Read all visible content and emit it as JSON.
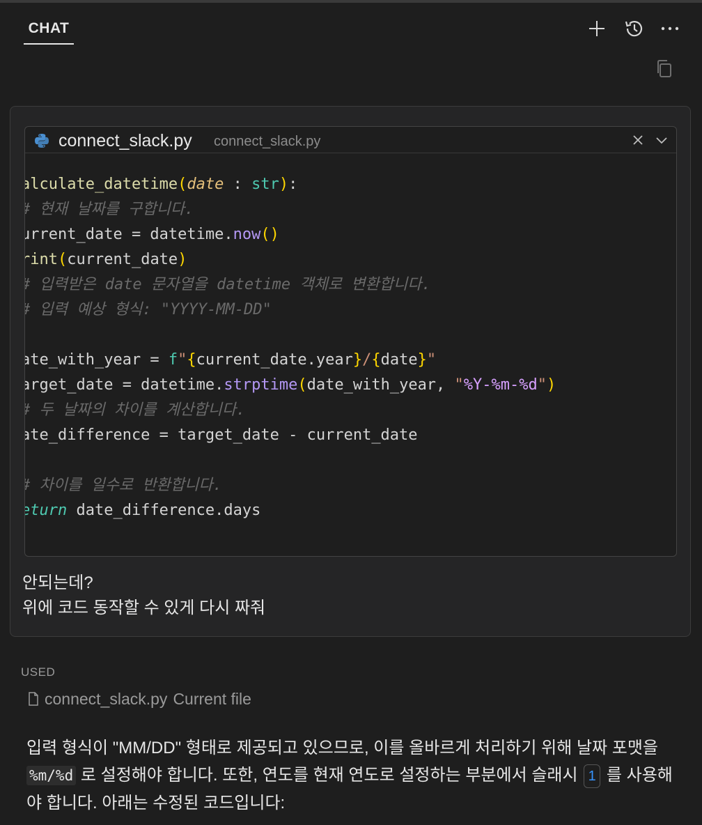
{
  "header": {
    "tab_label": "CHAT",
    "icons": [
      "plus-icon",
      "history-icon",
      "more-icon"
    ]
  },
  "user_message": {
    "attachment": {
      "file_name": "connect_slack.py",
      "file_path": "connect_slack.py",
      "lines": [
        "alculate_datetime(date : str):",
        "# 현재 날짜를 구합니다.",
        "urrent_date = datetime.now()",
        "rint(current_date)",
        "# 입력받은 date 문자열을 datetime 객체로 변환합니다.",
        "# 입력 예상 형식: \"YYYY-MM-DD\"",
        "",
        "ate_with_year = f\"{current_date.year}/{date}\"",
        "arget_date = datetime.strptime(date_with_year, \"%Y-%m-%d\")",
        "# 두 날짜의 차이를 계산합니다.",
        "ate_difference = target_date - current_date",
        "",
        "# 차이를 일수로 반환합니다.",
        "eturn date_difference.days"
      ]
    },
    "text_line1": "안되는데?",
    "text_line2": "위에 코드 동작할 수 있게 다시 짜줘"
  },
  "used": {
    "label": "USED",
    "file_name": "connect_slack.py",
    "file_desc": "Current file"
  },
  "answer": {
    "part1": "입력 형식이 \"MM/DD\" 형태로 제공되고 있으므로, 이를 올바르게 처리하기 위해 날짜 포맷을 ",
    "code": "%m/%d",
    "part2": " 로 설정해야 합니다. 또한, 연도를 현재 연도로 설정하는 부분에서 슬래시 ",
    "cite": "1",
    "part3": " 를 사용해야 합니다. 아래는 수정된 코드입니다:"
  }
}
